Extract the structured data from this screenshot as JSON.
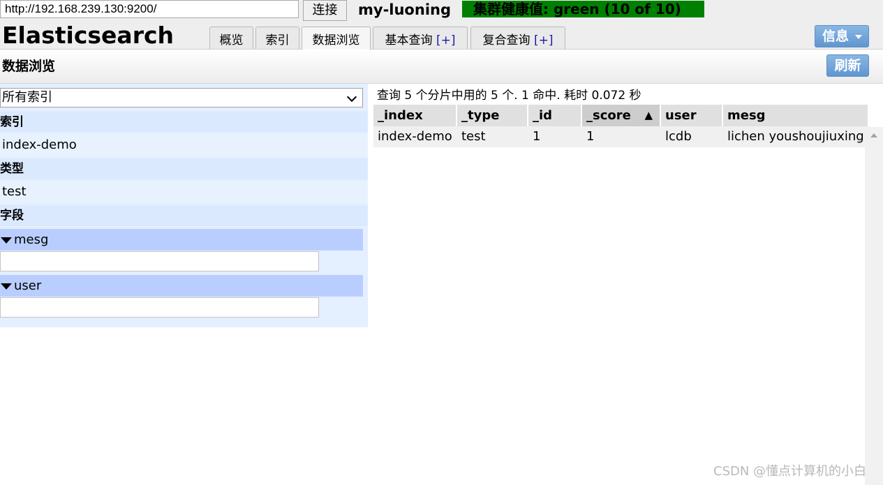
{
  "header": {
    "url": "http://192.168.239.130:9200/",
    "connect_label": "连接",
    "cluster_name": "my-luoning",
    "cluster_health": "集群健康值: green (10 of 10)",
    "app_title": "Elasticsearch",
    "tabs": [
      {
        "label": "概览",
        "plus": ""
      },
      {
        "label": "索引",
        "plus": ""
      },
      {
        "label": "数据浏览",
        "plus": "",
        "active": true
      },
      {
        "label": "基本查询 ",
        "plus": "[+]"
      },
      {
        "label": "复合查询 ",
        "plus": "[+]"
      }
    ],
    "info_label": "信息"
  },
  "toolbar": {
    "title": "数据浏览",
    "refresh_label": "刷新"
  },
  "sidebar": {
    "index_select": "所有索引",
    "index_header": "索引",
    "index_item": "index-demo",
    "type_header": "类型",
    "type_item": "test",
    "field_header": "字段",
    "fields": [
      {
        "name": "mesg"
      },
      {
        "name": "user"
      }
    ]
  },
  "results": {
    "summary": "查询 5 个分片中用的 5 个. 1 命中. 耗时 0.072 秒",
    "columns": [
      "_index",
      "_type",
      "_id",
      "_score",
      "user",
      "mesg"
    ],
    "sort_indicator": "▲",
    "rows": [
      [
        "index-demo",
        "test",
        "1",
        "1",
        "lcdb",
        "lichen youshoujiuxing"
      ]
    ]
  },
  "watermark": "CSDN @懂点计算机的小白"
}
